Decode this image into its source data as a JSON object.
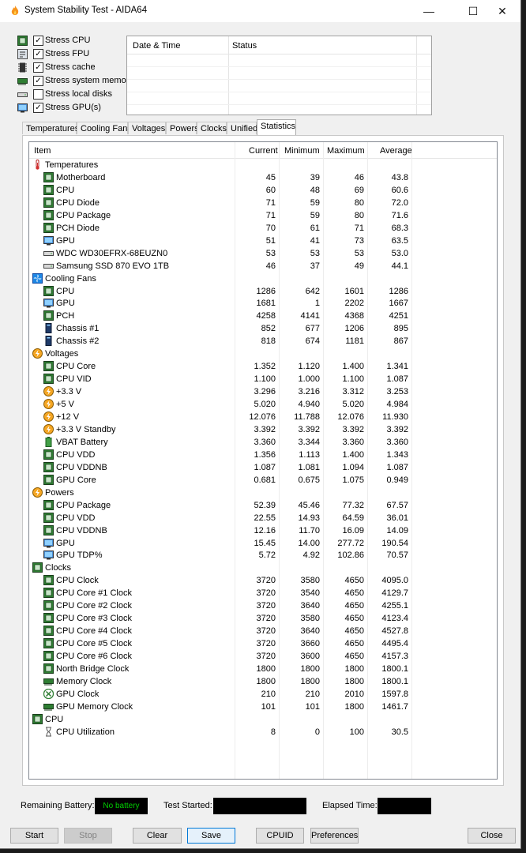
{
  "window": {
    "title": "System Stability Test - AIDA64"
  },
  "stress": [
    {
      "label": "Stress CPU",
      "checked": true,
      "icon": "cpu-chip-icon"
    },
    {
      "label": "Stress FPU",
      "checked": true,
      "icon": "fpu-icon"
    },
    {
      "label": "Stress cache",
      "checked": true,
      "icon": "cache-icon"
    },
    {
      "label": "Stress system memory",
      "checked": true,
      "icon": "memory-icon"
    },
    {
      "label": "Stress local disks",
      "checked": false,
      "icon": "disk-icon"
    },
    {
      "label": "Stress GPU(s)",
      "checked": true,
      "icon": "gpu-icon"
    }
  ],
  "status_table": {
    "col_datetime": "Date & Time",
    "col_status": "Status"
  },
  "tabs": [
    "Temperatures",
    "Cooling Fans",
    "Voltages",
    "Powers",
    "Clocks",
    "Unified",
    "Statistics"
  ],
  "active_tab": "Statistics",
  "grid": {
    "headers": {
      "item": "Item",
      "current": "Current",
      "minimum": "Minimum",
      "maximum": "Maximum",
      "average": "Average"
    },
    "rows": [
      {
        "type": "group",
        "name": "Temperatures",
        "icon": "thermometer-icon"
      },
      {
        "type": "item",
        "name": "Motherboard",
        "icon": "motherboard-icon",
        "cur": "45",
        "min": "39",
        "max": "46",
        "avg": "43.8"
      },
      {
        "type": "item",
        "name": "CPU",
        "icon": "cpu-chip-icon",
        "cur": "60",
        "min": "48",
        "max": "69",
        "avg": "60.6"
      },
      {
        "type": "item",
        "name": "CPU Diode",
        "icon": "cpu-chip-icon",
        "cur": "71",
        "min": "59",
        "max": "80",
        "avg": "72.0"
      },
      {
        "type": "item",
        "name": "CPU Package",
        "icon": "cpu-chip-icon",
        "cur": "71",
        "min": "59",
        "max": "80",
        "avg": "71.6"
      },
      {
        "type": "item",
        "name": "PCH Diode",
        "icon": "chip-icon",
        "cur": "70",
        "min": "61",
        "max": "71",
        "avg": "68.3"
      },
      {
        "type": "item",
        "name": "GPU",
        "icon": "gpu-icon",
        "cur": "51",
        "min": "41",
        "max": "73",
        "avg": "63.5"
      },
      {
        "type": "item",
        "name": "WDC WD30EFRX-68EUZN0",
        "icon": "disk-icon",
        "cur": "53",
        "min": "53",
        "max": "53",
        "avg": "53.0"
      },
      {
        "type": "item",
        "name": "Samsung SSD 870 EVO 1TB",
        "icon": "disk-icon",
        "cur": "46",
        "min": "37",
        "max": "49",
        "avg": "44.1"
      },
      {
        "type": "group",
        "name": "Cooling Fans",
        "icon": "fan-icon"
      },
      {
        "type": "item",
        "name": "CPU",
        "icon": "cpu-chip-icon",
        "cur": "1286",
        "min": "642",
        "max": "1601",
        "avg": "1286"
      },
      {
        "type": "item",
        "name": "GPU",
        "icon": "gpu-icon",
        "cur": "1681",
        "min": "1",
        "max": "2202",
        "avg": "1667"
      },
      {
        "type": "item",
        "name": "PCH",
        "icon": "chip-icon",
        "cur": "4258",
        "min": "4141",
        "max": "4368",
        "avg": "4251"
      },
      {
        "type": "item",
        "name": "Chassis #1",
        "icon": "chassis-icon",
        "cur": "852",
        "min": "677",
        "max": "1206",
        "avg": "895"
      },
      {
        "type": "item",
        "name": "Chassis #2",
        "icon": "chassis-icon",
        "cur": "818",
        "min": "674",
        "max": "1181",
        "avg": "867"
      },
      {
        "type": "group",
        "name": "Voltages",
        "icon": "voltage-icon"
      },
      {
        "type": "item",
        "name": "CPU Core",
        "icon": "cpu-chip-icon",
        "cur": "1.352",
        "min": "1.120",
        "max": "1.400",
        "avg": "1.341"
      },
      {
        "type": "item",
        "name": "CPU VID",
        "icon": "cpu-chip-icon",
        "cur": "1.100",
        "min": "1.000",
        "max": "1.100",
        "avg": "1.087"
      },
      {
        "type": "item",
        "name": "+3.3 V",
        "icon": "voltage-icon",
        "cur": "3.296",
        "min": "3.216",
        "max": "3.312",
        "avg": "3.253"
      },
      {
        "type": "item",
        "name": "+5 V",
        "icon": "voltage-icon",
        "cur": "5.020",
        "min": "4.940",
        "max": "5.020",
        "avg": "4.984"
      },
      {
        "type": "item",
        "name": "+12 V",
        "icon": "voltage-icon",
        "cur": "12.076",
        "min": "11.788",
        "max": "12.076",
        "avg": "11.930"
      },
      {
        "type": "item",
        "name": "+3.3 V Standby",
        "icon": "voltage-icon",
        "cur": "3.392",
        "min": "3.392",
        "max": "3.392",
        "avg": "3.392"
      },
      {
        "type": "item",
        "name": "VBAT Battery",
        "icon": "battery-icon",
        "cur": "3.360",
        "min": "3.344",
        "max": "3.360",
        "avg": "3.360"
      },
      {
        "type": "item",
        "name": "CPU VDD",
        "icon": "cpu-chip-icon",
        "cur": "1.356",
        "min": "1.113",
        "max": "1.400",
        "avg": "1.343"
      },
      {
        "type": "item",
        "name": "CPU VDDNB",
        "icon": "cpu-chip-icon",
        "cur": "1.087",
        "min": "1.081",
        "max": "1.094",
        "avg": "1.087"
      },
      {
        "type": "item",
        "name": "GPU Core",
        "icon": "cpu-chip-icon",
        "cur": "0.681",
        "min": "0.675",
        "max": "1.075",
        "avg": "0.949"
      },
      {
        "type": "group",
        "name": "Powers",
        "icon": "voltage-icon"
      },
      {
        "type": "item",
        "name": "CPU Package",
        "icon": "cpu-chip-icon",
        "cur": "52.39",
        "min": "45.46",
        "max": "77.32",
        "avg": "67.57"
      },
      {
        "type": "item",
        "name": "CPU VDD",
        "icon": "cpu-chip-icon",
        "cur": "22.55",
        "min": "14.93",
        "max": "64.59",
        "avg": "36.01"
      },
      {
        "type": "item",
        "name": "CPU VDDNB",
        "icon": "cpu-chip-icon",
        "cur": "12.16",
        "min": "11.70",
        "max": "16.09",
        "avg": "14.09"
      },
      {
        "type": "item",
        "name": "GPU",
        "icon": "gpu-icon",
        "cur": "15.45",
        "min": "14.00",
        "max": "277.72",
        "avg": "190.54"
      },
      {
        "type": "item",
        "name": "GPU TDP%",
        "icon": "gpu-icon",
        "cur": "5.72",
        "min": "4.92",
        "max": "102.86",
        "avg": "70.57"
      },
      {
        "type": "group",
        "name": "Clocks",
        "icon": "clock-chip-icon"
      },
      {
        "type": "item",
        "name": "CPU Clock",
        "icon": "cpu-chip-icon",
        "cur": "3720",
        "min": "3580",
        "max": "4650",
        "avg": "4095.0"
      },
      {
        "type": "item",
        "name": "CPU Core #1 Clock",
        "icon": "cpu-chip-icon",
        "cur": "3720",
        "min": "3540",
        "max": "4650",
        "avg": "4129.7"
      },
      {
        "type": "item",
        "name": "CPU Core #2 Clock",
        "icon": "cpu-chip-icon",
        "cur": "3720",
        "min": "3640",
        "max": "4650",
        "avg": "4255.1"
      },
      {
        "type": "item",
        "name": "CPU Core #3 Clock",
        "icon": "cpu-chip-icon",
        "cur": "3720",
        "min": "3580",
        "max": "4650",
        "avg": "4123.4"
      },
      {
        "type": "item",
        "name": "CPU Core #4 Clock",
        "icon": "cpu-chip-icon",
        "cur": "3720",
        "min": "3640",
        "max": "4650",
        "avg": "4527.8"
      },
      {
        "type": "item",
        "name": "CPU Core #5 Clock",
        "icon": "cpu-chip-icon",
        "cur": "3720",
        "min": "3660",
        "max": "4650",
        "avg": "4495.4"
      },
      {
        "type": "item",
        "name": "CPU Core #6 Clock",
        "icon": "cpu-chip-icon",
        "cur": "3720",
        "min": "3600",
        "max": "4650",
        "avg": "4157.3"
      },
      {
        "type": "item",
        "name": "North Bridge Clock",
        "icon": "cpu-chip-icon",
        "cur": "1800",
        "min": "1800",
        "max": "1800",
        "avg": "1800.1"
      },
      {
        "type": "item",
        "name": "Memory Clock",
        "icon": "memory-icon",
        "cur": "1800",
        "min": "1800",
        "max": "1800",
        "avg": "1800.1"
      },
      {
        "type": "item",
        "name": "GPU Clock",
        "icon": "xbox-icon",
        "cur": "210",
        "min": "210",
        "max": "2010",
        "avg": "1597.8"
      },
      {
        "type": "item",
        "name": "GPU Memory Clock",
        "icon": "memory-icon",
        "cur": "101",
        "min": "101",
        "max": "1800",
        "avg": "1461.7"
      },
      {
        "type": "group",
        "name": "CPU",
        "icon": "cpu-chip-icon"
      },
      {
        "type": "item",
        "name": "CPU Utilization",
        "icon": "hourglass-icon",
        "cur": "8",
        "min": "0",
        "max": "100",
        "avg": "30.5"
      }
    ]
  },
  "footer": {
    "remaining_battery_label": "Remaining Battery:",
    "battery_value": "No battery",
    "test_started_label": "Test Started:",
    "elapsed_time_label": "Elapsed Time:"
  },
  "buttons": {
    "start": "Start",
    "stop": "Stop",
    "clear": "Clear",
    "save": "Save",
    "cpuid": "CPUID",
    "preferences": "Preferences",
    "close": "Close"
  }
}
